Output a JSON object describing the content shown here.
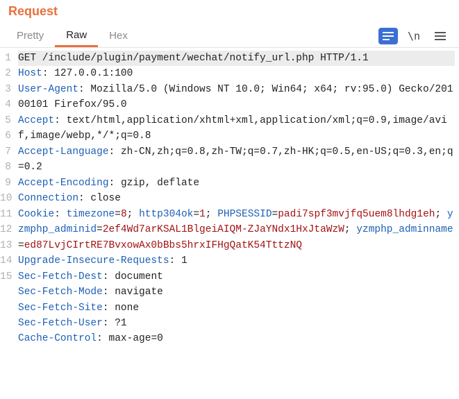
{
  "title": "Request",
  "tabs": {
    "pretty": "Pretty",
    "raw": "Raw",
    "hex": "Hex"
  },
  "toolbar": {
    "lines_icon_glyph": "≡",
    "back_icon_glyph": "\\n",
    "menu_icon_glyph": "≡"
  },
  "request": {
    "line": "GET /include/plugin/payment/wechat/notify_url.php HTTP/1.1",
    "headers": {
      "host": {
        "k": "Host",
        "v": "127.0.0.1:100"
      },
      "ua": {
        "k": "User-Agent",
        "v": "Mozilla/5.0 (Windows NT 10.0; Win64; x64; rv:95.0) Gecko/20100101 Firefox/95.0"
      },
      "accept": {
        "k": "Accept",
        "v": "text/html,application/xhtml+xml,application/xml;q=0.9,image/avif,image/webp,*/*;q=0.8"
      },
      "acclang": {
        "k": "Accept-Language",
        "v": "zh-CN,zh;q=0.8,zh-TW;q=0.7,zh-HK;q=0.5,en-US;q=0.3,en;q=0.2"
      },
      "accenc": {
        "k": "Accept-Encoding",
        "v": "gzip, deflate"
      },
      "conn": {
        "k": "Connection",
        "v": "close"
      },
      "cookie": {
        "k": "Cookie",
        "pairs": [
          {
            "k": "timezone",
            "v": "8"
          },
          {
            "k": "http304ok",
            "v": "1"
          },
          {
            "k": "PHPSESSID",
            "v": "padi7spf3mvjfq5uem8lhdg1eh"
          },
          {
            "k": "yzmphp_adminid",
            "v": "2ef4Wd7arKSAL1BlgeiAIQM-ZJaYNdx1HxJtaWzW"
          },
          {
            "k": "yzmphp_adminname",
            "v": "ed87LvjCIrtRE7BvxowAx0bBbs5hrxIFHgQatK54TttzNQ"
          }
        ]
      },
      "uir": {
        "k": "Upgrade-Insecure-Requests",
        "v": "1"
      },
      "sfd": {
        "k": "Sec-Fetch-Dest",
        "v": "document"
      },
      "sfm": {
        "k": "Sec-Fetch-Mode",
        "v": "navigate"
      },
      "sfs": {
        "k": "Sec-Fetch-Site",
        "v": "none"
      },
      "sfu": {
        "k": "Sec-Fetch-User",
        "v": "?1"
      },
      "cc": {
        "k": "Cache-Control",
        "v": "max-age=0"
      }
    }
  },
  "gutter": [
    "1",
    "2",
    "3",
    "4",
    "5",
    "6",
    "7",
    "8",
    "9",
    "10",
    "11",
    "12",
    "13",
    "14",
    "15"
  ]
}
